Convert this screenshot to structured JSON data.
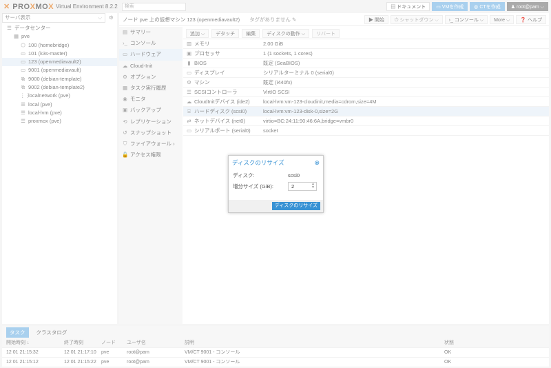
{
  "header": {
    "logo": "PROXMOX",
    "version": "Virtual Environment 8.2.2",
    "search_placeholder": "検索",
    "docs": "ドキュメント",
    "create_vm": "VMを作成",
    "create_ct": "CTを作成",
    "user": "root@pam"
  },
  "tree": {
    "view": "サーバ表示",
    "items": [
      {
        "label": "データセンター",
        "icon": "datacenter-icon",
        "indent": 0
      },
      {
        "label": "pve",
        "icon": "node-icon",
        "indent": 1
      },
      {
        "label": "100 (homebridge)",
        "icon": "container-icon",
        "indent": 2
      },
      {
        "label": "101 (k3s-master)",
        "icon": "vm-icon",
        "indent": 2
      },
      {
        "label": "123 (openmediavault2)",
        "icon": "vm-icon",
        "indent": 2,
        "selected": true
      },
      {
        "label": "9001 (openmediavault)",
        "icon": "vm-running-icon",
        "indent": 2
      },
      {
        "label": "9000 (debian-template)",
        "icon": "template-icon",
        "indent": 2
      },
      {
        "label": "9002 (debian-template2)",
        "icon": "template-icon",
        "indent": 2
      },
      {
        "label": "localnetwork (pve)",
        "icon": "sdn-icon",
        "indent": 2
      },
      {
        "label": "local (pve)",
        "icon": "storage-icon",
        "indent": 2
      },
      {
        "label": "local-lvm (pve)",
        "icon": "storage-icon",
        "indent": 2
      },
      {
        "label": "proxmox (pve)",
        "icon": "storage-icon",
        "indent": 2
      }
    ]
  },
  "page": {
    "title": "ノード pve 上の仮想マシン 123 (openmediavault2)",
    "tags": "タグがありません",
    "start": "開始",
    "shutdown": "シャットダウン",
    "console": "コンソール",
    "more": "More",
    "help": "ヘルプ"
  },
  "nav": [
    {
      "label": "サマリー",
      "icon": "▤"
    },
    {
      "label": "コンソール",
      "icon": "›_"
    },
    {
      "label": "ハードウェア",
      "icon": "▭",
      "selected": true
    },
    {
      "label": "Cloud-Init",
      "icon": "☁"
    },
    {
      "label": "オプション",
      "icon": "⚙"
    },
    {
      "label": "タスク実行履歴",
      "icon": "▦"
    },
    {
      "label": "モニタ",
      "icon": "◉"
    },
    {
      "label": "バックアップ",
      "icon": "▣"
    },
    {
      "label": "レプリケーション",
      "icon": "⟲"
    },
    {
      "label": "スナップショット",
      "icon": "↺"
    },
    {
      "label": "ファイアウォール ›",
      "icon": "⛉"
    },
    {
      "label": "アクセス権限",
      "icon": "🔓"
    }
  ],
  "hw_toolbar": {
    "add": "追加 ⌵",
    "detach": "デタッチ",
    "edit": "編集",
    "disk_action": "ディスクの動作 ⌵",
    "revert": "リバート"
  },
  "hardware": [
    {
      "k": "メモリ",
      "v": "2.00 GiB",
      "icon": "▥"
    },
    {
      "k": "プロセッサ",
      "v": "1 (1 sockets, 1 cores)",
      "icon": "▣"
    },
    {
      "k": "BIOS",
      "v": "既定 (SeaBIOS)",
      "icon": "▮"
    },
    {
      "k": "ディスプレイ",
      "v": "シリアルターミナル 0 (serial0)",
      "icon": "▭"
    },
    {
      "k": "マシン",
      "v": "既定 (i440fx)",
      "icon": "⚙"
    },
    {
      "k": "SCSIコントローラ",
      "v": "VirtIO SCSI",
      "icon": "☰"
    },
    {
      "k": "CloudInitデバイス (ide2)",
      "v": "local-lvm:vm-123-cloudinit,media=cdrom,size=4M",
      "icon": "☁"
    },
    {
      "k": "ハードディスク (scsi0)",
      "v": "local-lvm:vm-123-disk-0,size=2G",
      "icon": "⌸",
      "selected": true
    },
    {
      "k": "ネットデバイス (net0)",
      "v": "virtio=BC:24:11:90:46:6A,bridge=vmbr0",
      "icon": "⇄"
    },
    {
      "k": "シリアルポート (serial0)",
      "v": "socket",
      "icon": "▭"
    }
  ],
  "bottom": {
    "tabs": [
      "タスク",
      "クラスタログ"
    ],
    "columns": [
      "開始時刻 ↓",
      "終了時刻",
      "ノード",
      "ユーザ名",
      "説明",
      "状態"
    ],
    "rows": [
      [
        "12 01 21:15:32",
        "12 01 21:17:10",
        "pve",
        "root@pam",
        "VM/CT 9001 - コンソール",
        "OK"
      ],
      [
        "12 01 21:15:12",
        "12 01 21:15:22",
        "pve",
        "root@pam",
        "VM/CT 9001 - コンソール",
        "OK"
      ]
    ]
  },
  "dialog": {
    "title": "ディスクのリサイズ",
    "disk_label": "ディスク:",
    "disk_value": "scsi0",
    "size_label": "増分サイズ (GiB):",
    "size_value": "2",
    "submit": "ディスクのリサイズ"
  }
}
